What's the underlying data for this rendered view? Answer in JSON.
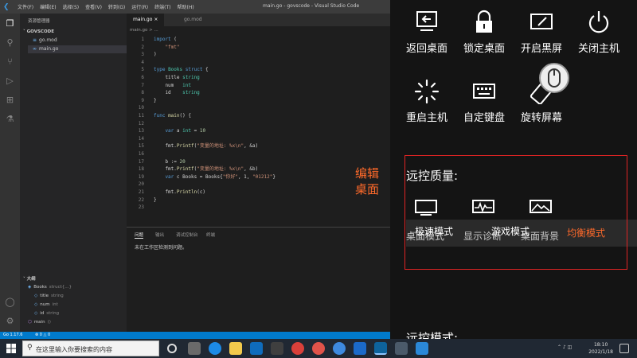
{
  "titlebar": {
    "menus": [
      "文件(F)",
      "编辑(E)",
      "选择(S)",
      "查看(V)",
      "转到(G)",
      "运行(R)",
      "终端(T)",
      "帮助(H)"
    ],
    "window_title": "main.go - govscode - Visual Studio Code"
  },
  "sidebar": {
    "title": "资源管理器",
    "section": "GOVSCODE",
    "files": [
      "go.mod",
      "main.go"
    ],
    "outline_title": "大纲",
    "outline": [
      {
        "name": "Books",
        "detail": "struct{...}"
      },
      {
        "name": "title",
        "detail": "string"
      },
      {
        "name": "num",
        "detail": "int"
      },
      {
        "name": "id",
        "detail": "string"
      },
      {
        "name": "main",
        "detail": "()"
      }
    ]
  },
  "tabs": [
    {
      "label": "main.go",
      "close": "×"
    },
    {
      "label": "go.mod"
    }
  ],
  "breadcrumb": "main.go > ...",
  "code": [
    {
      "n": "1",
      "parts": [
        [
          "kw",
          "import"
        ],
        [
          "plain",
          " ("
        ]
      ]
    },
    {
      "n": "2",
      "parts": [
        [
          "str",
          "    \"fmt\""
        ]
      ]
    },
    {
      "n": "3",
      "parts": [
        [
          "plain",
          ")"
        ]
      ]
    },
    {
      "n": "4",
      "parts": []
    },
    {
      "n": "5",
      "parts": [
        [
          "kw",
          "type"
        ],
        [
          "ty",
          " Books"
        ],
        [
          "kw",
          " struct"
        ],
        [
          "plain",
          " {"
        ]
      ]
    },
    {
      "n": "6",
      "parts": [
        [
          "plain",
          "    title "
        ],
        [
          "ty",
          "string"
        ]
      ]
    },
    {
      "n": "7",
      "parts": [
        [
          "plain",
          "    num   "
        ],
        [
          "ty",
          "int"
        ]
      ]
    },
    {
      "n": "8",
      "parts": [
        [
          "plain",
          "    id    "
        ],
        [
          "ty",
          "string"
        ]
      ]
    },
    {
      "n": "9",
      "parts": [
        [
          "plain",
          "}"
        ]
      ]
    },
    {
      "n": "10",
      "parts": []
    },
    {
      "n": "11",
      "parts": [
        [
          "kw",
          "func"
        ],
        [
          "fn",
          " main"
        ],
        [
          "plain",
          "() {"
        ]
      ]
    },
    {
      "n": "12",
      "parts": []
    },
    {
      "n": "13",
      "parts": [
        [
          "kw",
          "    var"
        ],
        [
          "plain",
          " a "
        ],
        [
          "ty",
          "int"
        ],
        [
          "plain",
          " = "
        ],
        [
          "num",
          "10"
        ]
      ]
    },
    {
      "n": "14",
      "parts": []
    },
    {
      "n": "15",
      "parts": [
        [
          "plain",
          "    fmt."
        ],
        [
          "fn",
          "Printf"
        ],
        [
          "plain",
          "("
        ],
        [
          "str",
          "\"变量的地址: %x\\n\""
        ],
        [
          "plain",
          ", &a)"
        ]
      ]
    },
    {
      "n": "16",
      "parts": []
    },
    {
      "n": "17",
      "parts": [
        [
          "plain",
          "    b := "
        ],
        [
          "num",
          "20"
        ]
      ]
    },
    {
      "n": "18",
      "parts": [
        [
          "plain",
          "    fmt."
        ],
        [
          "fn",
          "Printf"
        ],
        [
          "plain",
          "("
        ],
        [
          "str",
          "\"变量的地址: %x\\n\""
        ],
        [
          "plain",
          ", &b)"
        ]
      ]
    },
    {
      "n": "19",
      "parts": [
        [
          "kw",
          "    var"
        ],
        [
          "plain",
          " c Books = Books{"
        ],
        [
          "str",
          "\"你好\""
        ],
        [
          "plain",
          ", 1, "
        ],
        [
          "str",
          "\"01212\""
        ],
        [
          "plain",
          "}"
        ]
      ]
    },
    {
      "n": "20",
      "parts": []
    },
    {
      "n": "21",
      "parts": [
        [
          "plain",
          "    fmt."
        ],
        [
          "fn",
          "Println"
        ],
        [
          "plain",
          "(c)"
        ]
      ]
    },
    {
      "n": "22",
      "parts": [
        [
          "plain",
          "}"
        ]
      ]
    },
    {
      "n": "23",
      "parts": []
    }
  ],
  "panel": {
    "tabs": [
      "问题",
      "输出",
      "调试控制台",
      "终端"
    ],
    "message": "未在工作区检测到问题。"
  },
  "statusbar": {
    "go_version": "Go 1.17.6",
    "problems": "⊗ 0 △ 0"
  },
  "overlay": {
    "buttons": [
      {
        "label": "返回桌面",
        "icon": "back-desktop-icon"
      },
      {
        "label": "锁定桌面",
        "icon": "lock-icon"
      },
      {
        "label": "开启黑屏",
        "icon": "black-screen-icon"
      },
      {
        "label": "关闭主机",
        "icon": "power-icon"
      },
      {
        "label": "重启主机",
        "icon": "restart-icon"
      },
      {
        "label": "自定键盘",
        "icon": "keyboard-icon"
      },
      {
        "label": "旋转屏幕",
        "icon": "rotate-icon"
      }
    ],
    "quality_title": "远控质量:",
    "modes_row1": [
      "极速模式",
      "游戏模式"
    ],
    "modes_row2": [
      "桌面模式",
      "显示诊断",
      "桌面背景",
      "均衡模式"
    ],
    "selected_mode": "均衡模式",
    "edit_label": "编辑桌面",
    "control_mode_title": "远控模式:",
    "accent_color": "#ff6a2a",
    "box_color": "#e02424"
  },
  "taskbar": {
    "search_placeholder": "在这里输入你要搜索的内容",
    "clock_time": "18:10",
    "clock_date": "2022/1/18"
  }
}
